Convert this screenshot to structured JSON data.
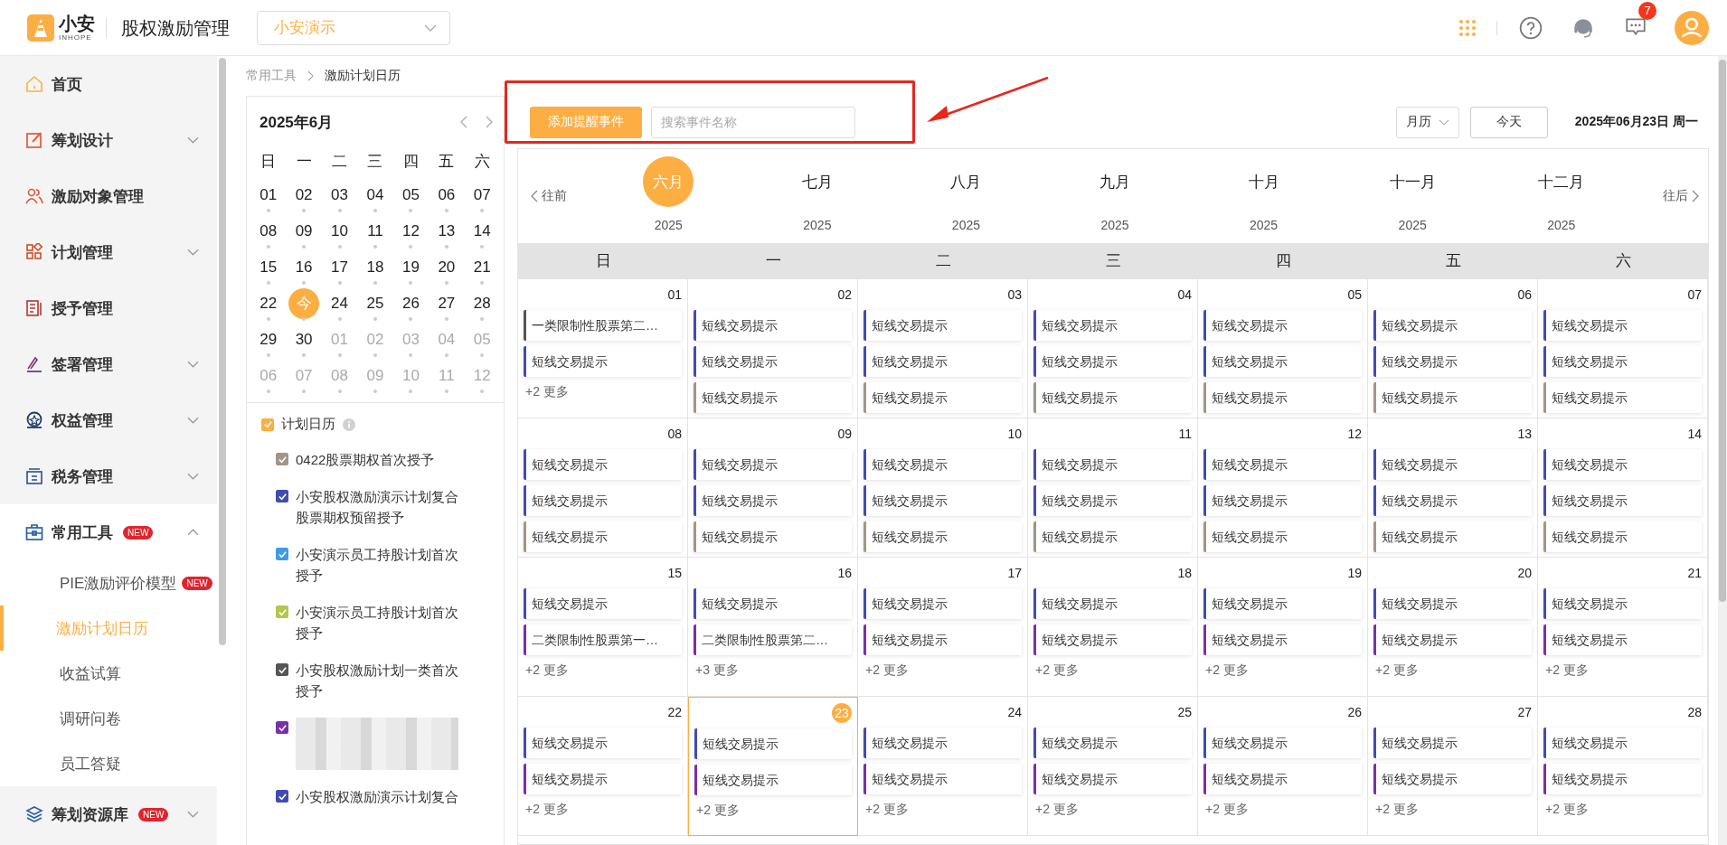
{
  "header": {
    "logo_text": "小安",
    "logo_sub": "INHOPE",
    "app_title": "股权激励管理",
    "company_select": "小安演示",
    "notifications": "7"
  },
  "sidebar": {
    "items": [
      {
        "label": "首页"
      },
      {
        "label": "筹划设计",
        "expanded": false
      },
      {
        "label": "激励对象管理"
      },
      {
        "label": "计划管理",
        "expanded": false
      },
      {
        "label": "授予管理"
      },
      {
        "label": "签署管理",
        "expanded": false
      },
      {
        "label": "权益管理",
        "expanded": false
      },
      {
        "label": "税务管理",
        "expanded": false
      },
      {
        "label": "常用工具",
        "badge": "NEW",
        "expanded": true,
        "children": [
          {
            "label": "PIE激励评价模型",
            "badge": "NEW",
            "selected": false
          },
          {
            "label": "激励计划日历",
            "selected": true
          },
          {
            "label": "收益试算",
            "selected": false
          },
          {
            "label": "调研问卷",
            "selected": false
          },
          {
            "label": "员工答疑",
            "selected": false
          }
        ]
      },
      {
        "label": "筹划资源库",
        "badge": "NEW",
        "expanded": false
      }
    ]
  },
  "breadcrumb": [
    "常用工具",
    "激励计划日历"
  ],
  "mini_calendar": {
    "title": "2025年6月",
    "weekdays": [
      "日",
      "一",
      "二",
      "三",
      "四",
      "五",
      "六"
    ],
    "weeks": [
      [
        {
          "day": "01",
          "other_month": false,
          "today": false
        },
        {
          "day": "02",
          "other_month": false,
          "today": false
        },
        {
          "day": "03",
          "other_month": false,
          "today": false
        },
        {
          "day": "04",
          "other_month": false,
          "today": false
        },
        {
          "day": "05",
          "other_month": false,
          "today": false
        },
        {
          "day": "06",
          "other_month": false,
          "today": false
        },
        {
          "day": "07",
          "other_month": false,
          "today": false
        }
      ],
      [
        {
          "day": "08",
          "other_month": false,
          "today": false
        },
        {
          "day": "09",
          "other_month": false,
          "today": false
        },
        {
          "day": "10",
          "other_month": false,
          "today": false
        },
        {
          "day": "11",
          "other_month": false,
          "today": false
        },
        {
          "day": "12",
          "other_month": false,
          "today": false
        },
        {
          "day": "13",
          "other_month": false,
          "today": false
        },
        {
          "day": "14",
          "other_month": false,
          "today": false
        }
      ],
      [
        {
          "day": "15",
          "other_month": false,
          "today": false
        },
        {
          "day": "16",
          "other_month": false,
          "today": false
        },
        {
          "day": "17",
          "other_month": false,
          "today": false
        },
        {
          "day": "18",
          "other_month": false,
          "today": false
        },
        {
          "day": "19",
          "other_month": false,
          "today": false
        },
        {
          "day": "20",
          "other_month": false,
          "today": false
        },
        {
          "day": "21",
          "other_month": false,
          "today": false
        }
      ],
      [
        {
          "day": "22",
          "other_month": false,
          "today": false
        },
        {
          "day": "今",
          "other_month": false,
          "today": true
        },
        {
          "day": "24",
          "other_month": false,
          "today": false
        },
        {
          "day": "25",
          "other_month": false,
          "today": false
        },
        {
          "day": "26",
          "other_month": false,
          "today": false
        },
        {
          "day": "27",
          "other_month": false,
          "today": false
        },
        {
          "day": "28",
          "other_month": false,
          "today": false
        }
      ],
      [
        {
          "day": "29",
          "other_month": false,
          "today": false
        },
        {
          "day": "30",
          "other_month": false,
          "today": false
        },
        {
          "day": "01",
          "other_month": true,
          "today": false
        },
        {
          "day": "02",
          "other_month": true,
          "today": false
        },
        {
          "day": "03",
          "other_month": true,
          "today": false
        },
        {
          "day": "04",
          "other_month": true,
          "today": false
        },
        {
          "day": "05",
          "other_month": true,
          "today": false
        }
      ],
      [
        {
          "day": "06",
          "other_month": true,
          "today": false
        },
        {
          "day": "07",
          "other_month": true,
          "today": false
        },
        {
          "day": "08",
          "other_month": true,
          "today": false
        },
        {
          "day": "09",
          "other_month": true,
          "today": false
        },
        {
          "day": "10",
          "other_month": true,
          "today": false
        },
        {
          "day": "11",
          "other_month": true,
          "today": false
        },
        {
          "day": "12",
          "other_month": true,
          "today": false
        }
      ]
    ]
  },
  "legend": {
    "title": "计划日历",
    "checked": true,
    "items": [
      {
        "label": "0422股票期权首次授予",
        "checked": true,
        "color": "#a39586"
      },
      {
        "label": "小安股权激励演示计划复合股票期权预留授予",
        "checked": true,
        "color": "#3f4db3"
      },
      {
        "label": "小安演示员工持股计划首次授予",
        "checked": true,
        "color": "#3d9be9"
      },
      {
        "label": "小安演示员工持股计划首次授予",
        "checked": true,
        "color": "#b5c64a"
      },
      {
        "label": "小安股权激励计划一类首次授予",
        "checked": true,
        "color": "#555555"
      },
      {
        "kind": "redacted",
        "checked": true,
        "color": "#7b2fa8"
      },
      {
        "label": "小安股权激励演示计划复合",
        "checked": true,
        "color": "#3f4db3"
      }
    ]
  },
  "toolbar": {
    "add_button": "添加提醒事件",
    "search_placeholder": "搜索事件名称",
    "view_select": "月历",
    "today_button": "今天",
    "current_date": "2025年06月23日 周一"
  },
  "month_strip": {
    "prev": "往前",
    "next": "往后",
    "months": [
      {
        "label": "六月",
        "year": "2025",
        "selected": true
      },
      {
        "label": "七月",
        "year": "2025",
        "selected": false
      },
      {
        "label": "八月",
        "year": "2025",
        "selected": false
      },
      {
        "label": "九月",
        "year": "2025",
        "selected": false
      },
      {
        "label": "十月",
        "year": "2025",
        "selected": false
      },
      {
        "label": "十一月",
        "year": "2025",
        "selected": false
      },
      {
        "label": "十二月",
        "year": "2025",
        "selected": false
      }
    ]
  },
  "calendar": {
    "weekdays": [
      "日",
      "一",
      "二",
      "三",
      "四",
      "五",
      "六"
    ],
    "weeks": [
      [
        {
          "date": "01",
          "today": false,
          "events": [
            {
              "label": "一类限制性股票第二…",
              "color": "#555555"
            },
            {
              "label": "短线交易提示",
              "color": "#3f4db3"
            }
          ],
          "more": "+2 更多"
        },
        {
          "date": "02",
          "today": false,
          "events": [
            {
              "label": "短线交易提示",
              "color": "#3f4db3"
            },
            {
              "label": "短线交易提示",
              "color": "#3f4db3"
            },
            {
              "label": "短线交易提示",
              "color": "#a39586"
            }
          ]
        },
        {
          "date": "03",
          "today": false,
          "events": [
            {
              "label": "短线交易提示",
              "color": "#3f4db3"
            },
            {
              "label": "短线交易提示",
              "color": "#3f4db3"
            },
            {
              "label": "短线交易提示",
              "color": "#a39586"
            }
          ]
        },
        {
          "date": "04",
          "today": false,
          "events": [
            {
              "label": "短线交易提示",
              "color": "#3f4db3"
            },
            {
              "label": "短线交易提示",
              "color": "#3f4db3"
            },
            {
              "label": "短线交易提示",
              "color": "#a39586"
            }
          ]
        },
        {
          "date": "05",
          "today": false,
          "events": [
            {
              "label": "短线交易提示",
              "color": "#3f4db3"
            },
            {
              "label": "短线交易提示",
              "color": "#3f4db3"
            },
            {
              "label": "短线交易提示",
              "color": "#a39586"
            }
          ]
        },
        {
          "date": "06",
          "today": false,
          "events": [
            {
              "label": "短线交易提示",
              "color": "#3f4db3"
            },
            {
              "label": "短线交易提示",
              "color": "#3f4db3"
            },
            {
              "label": "短线交易提示",
              "color": "#a39586"
            }
          ]
        },
        {
          "date": "07",
          "today": false,
          "events": [
            {
              "label": "短线交易提示",
              "color": "#3f4db3"
            },
            {
              "label": "短线交易提示",
              "color": "#3f4db3"
            },
            {
              "label": "短线交易提示",
              "color": "#a39586"
            }
          ]
        }
      ],
      [
        {
          "date": "08",
          "today": false,
          "events": [
            {
              "label": "短线交易提示",
              "color": "#3f4db3"
            },
            {
              "label": "短线交易提示",
              "color": "#3f4db3"
            },
            {
              "label": "短线交易提示",
              "color": "#a39586"
            }
          ]
        },
        {
          "date": "09",
          "today": false,
          "events": [
            {
              "label": "短线交易提示",
              "color": "#3f4db3"
            },
            {
              "label": "短线交易提示",
              "color": "#3f4db3"
            },
            {
              "label": "短线交易提示",
              "color": "#a39586"
            }
          ]
        },
        {
          "date": "10",
          "today": false,
          "events": [
            {
              "label": "短线交易提示",
              "color": "#3f4db3"
            },
            {
              "label": "短线交易提示",
              "color": "#3f4db3"
            },
            {
              "label": "短线交易提示",
              "color": "#a39586"
            }
          ]
        },
        {
          "date": "11",
          "today": false,
          "events": [
            {
              "label": "短线交易提示",
              "color": "#3f4db3"
            },
            {
              "label": "短线交易提示",
              "color": "#3f4db3"
            },
            {
              "label": "短线交易提示",
              "color": "#a39586"
            }
          ]
        },
        {
          "date": "12",
          "today": false,
          "events": [
            {
              "label": "短线交易提示",
              "color": "#3f4db3"
            },
            {
              "label": "短线交易提示",
              "color": "#3f4db3"
            },
            {
              "label": "短线交易提示",
              "color": "#a39586"
            }
          ]
        },
        {
          "date": "13",
          "today": false,
          "events": [
            {
              "label": "短线交易提示",
              "color": "#3f4db3"
            },
            {
              "label": "短线交易提示",
              "color": "#3f4db3"
            },
            {
              "label": "短线交易提示",
              "color": "#a39586"
            }
          ]
        },
        {
          "date": "14",
          "today": false,
          "events": [
            {
              "label": "短线交易提示",
              "color": "#3f4db3"
            },
            {
              "label": "短线交易提示",
              "color": "#3f4db3"
            },
            {
              "label": "短线交易提示",
              "color": "#a39586"
            }
          ]
        }
      ],
      [
        {
          "date": "15",
          "today": false,
          "events": [
            {
              "label": "短线交易提示",
              "color": "#3f4db3"
            },
            {
              "label": "二类限制性股票第一…",
              "color": "#7b2fa8"
            }
          ],
          "more": "+2 更多"
        },
        {
          "date": "16",
          "today": false,
          "events": [
            {
              "label": "短线交易提示",
              "color": "#3f4db3"
            },
            {
              "label": "二类限制性股票第二…",
              "color": "#7b2fa8"
            }
          ],
          "more": "+3 更多"
        },
        {
          "date": "17",
          "today": false,
          "events": [
            {
              "label": "短线交易提示",
              "color": "#3f4db3"
            },
            {
              "label": "短线交易提示",
              "color": "#7b2fa8"
            }
          ],
          "more": "+2 更多"
        },
        {
          "date": "18",
          "today": false,
          "events": [
            {
              "label": "短线交易提示",
              "color": "#3f4db3"
            },
            {
              "label": "短线交易提示",
              "color": "#7b2fa8"
            }
          ],
          "more": "+2 更多"
        },
        {
          "date": "19",
          "today": false,
          "events": [
            {
              "label": "短线交易提示",
              "color": "#3f4db3"
            },
            {
              "label": "短线交易提示",
              "color": "#7b2fa8"
            }
          ],
          "more": "+2 更多"
        },
        {
          "date": "20",
          "today": false,
          "events": [
            {
              "label": "短线交易提示",
              "color": "#3f4db3"
            },
            {
              "label": "短线交易提示",
              "color": "#7b2fa8"
            }
          ],
          "more": "+2 更多"
        },
        {
          "date": "21",
          "today": false,
          "events": [
            {
              "label": "短线交易提示",
              "color": "#3f4db3"
            },
            {
              "label": "短线交易提示",
              "color": "#7b2fa8"
            }
          ],
          "more": "+2 更多"
        }
      ],
      [
        {
          "date": "22",
          "today": false,
          "events": [
            {
              "label": "短线交易提示",
              "color": "#3f4db3"
            },
            {
              "label": "短线交易提示",
              "color": "#7b2fa8"
            }
          ],
          "more": "+2 更多"
        },
        {
          "date": "23",
          "today": true,
          "events": [
            {
              "label": "短线交易提示",
              "color": "#3f4db3"
            },
            {
              "label": "短线交易提示",
              "color": "#7b2fa8"
            }
          ],
          "more": "+2 更多"
        },
        {
          "date": "24",
          "today": false,
          "events": [
            {
              "label": "短线交易提示",
              "color": "#3f4db3"
            },
            {
              "label": "短线交易提示",
              "color": "#7b2fa8"
            }
          ],
          "more": "+2 更多"
        },
        {
          "date": "25",
          "today": false,
          "events": [
            {
              "label": "短线交易提示",
              "color": "#3f4db3"
            },
            {
              "label": "短线交易提示",
              "color": "#7b2fa8"
            }
          ],
          "more": "+2 更多"
        },
        {
          "date": "26",
          "today": false,
          "events": [
            {
              "label": "短线交易提示",
              "color": "#3f4db3"
            },
            {
              "label": "短线交易提示",
              "color": "#7b2fa8"
            }
          ],
          "more": "+2 更多"
        },
        {
          "date": "27",
          "today": false,
          "events": [
            {
              "label": "短线交易提示",
              "color": "#3f4db3"
            },
            {
              "label": "短线交易提示",
              "color": "#7b2fa8"
            }
          ],
          "more": "+2 更多"
        },
        {
          "date": "28",
          "today": false,
          "events": [
            {
              "label": "短线交易提示",
              "color": "#3f4db3"
            },
            {
              "label": "短线交易提示",
              "color": "#7b2fa8"
            }
          ],
          "more": "+2 更多"
        }
      ]
    ]
  }
}
